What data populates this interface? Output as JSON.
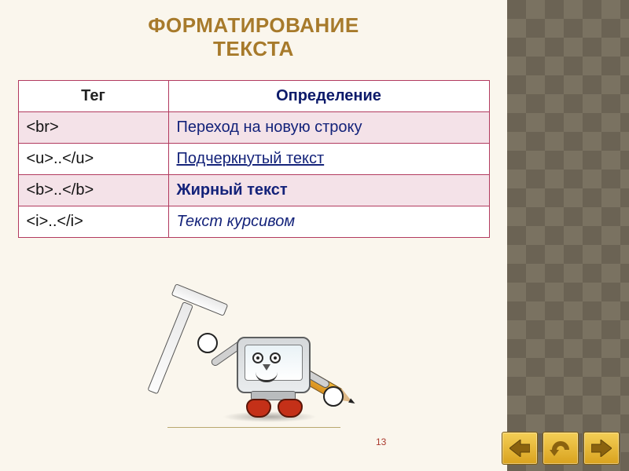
{
  "title_line1": "ФОРМАТИРОВАНИЕ",
  "title_line2": "ТЕКСТА",
  "table": {
    "headers": {
      "tag": "Тег",
      "definition": "Определение"
    },
    "rows": [
      {
        "tag": "<br>",
        "definition": "Переход на новую строку",
        "style": "plain",
        "shade": true
      },
      {
        "tag": "<u>..</u>",
        "definition": "Подчеркнутый текст",
        "style": "underline",
        "shade": false
      },
      {
        "tag": "<b>..</b>",
        "definition": "Жирный текст",
        "style": "bold",
        "shade": true
      },
      {
        "tag": "<i>..</i>",
        "definition": "Текст курсивом",
        "style": "italic",
        "shade": false
      }
    ]
  },
  "page_number": "13",
  "nav": {
    "prev_icon": "arrow-left-icon",
    "home_icon": "u-turn-icon",
    "next_icon": "arrow-right-icon"
  },
  "mascot_alt": "Компьютер-талисман с линейкой и карандашом",
  "colors": {
    "title": "#a77a2b",
    "table_border": "#b23a5f",
    "text_link": "#14237a",
    "nav_button": "#e9b733"
  }
}
